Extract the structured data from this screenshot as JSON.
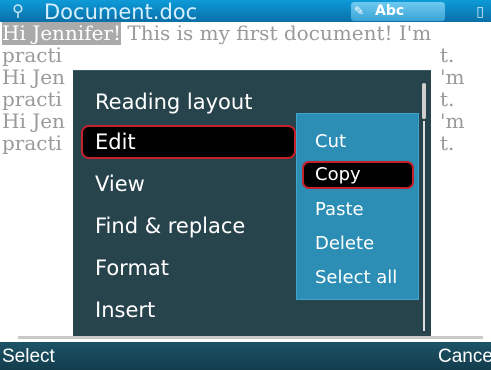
{
  "status_bar": {
    "title": "Document.doc",
    "edit_indicator": "Abc",
    "signal_icon": "signal-icon",
    "battery_icon": "battery-icon"
  },
  "document": {
    "lines": [
      {
        "highlight": "Hi Jennifer!",
        "text": " This is my first document! I'm"
      },
      {
        "highlight": "",
        "text": "practi"
      },
      {
        "highlight": "",
        "text": "Hi Jen"
      },
      {
        "highlight": "",
        "text": "practi"
      },
      {
        "highlight": "",
        "text": "Hi Jen"
      },
      {
        "highlight": "",
        "text": "practi"
      }
    ],
    "right_fragments": [
      "t.",
      "'m",
      "t.",
      "'m",
      "t."
    ]
  },
  "menu": {
    "items": [
      "Reading layout",
      "Edit",
      "View",
      "Find & replace",
      "Format",
      "Insert"
    ],
    "selected_index": 1
  },
  "submenu": {
    "items": [
      "Cut",
      "Copy",
      "Paste",
      "Delete",
      "Select all"
    ],
    "selected_index": 1
  },
  "softkeys": {
    "left": "Select",
    "right": "Cance"
  },
  "colors": {
    "title_bar": "#0a84c4",
    "menu_bg": "#27434c",
    "submenu_bg": "#2c8eb4",
    "selection_border": "#c4212b"
  }
}
